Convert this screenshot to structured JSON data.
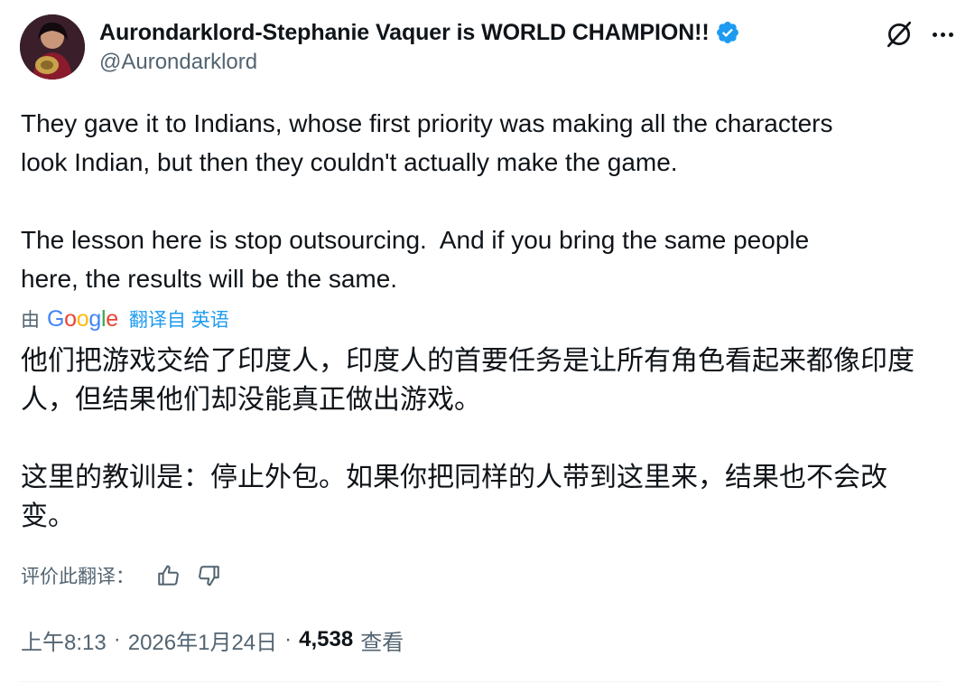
{
  "author": {
    "display_name": "Aurondarklord-Stephanie Vaquer is WORLD CHAMPION!!",
    "handle": "@Aurondarklord",
    "verified": true,
    "avatar_icon": "user-avatar"
  },
  "icons": {
    "verified": "verified-badge-icon",
    "grok": "grok-icon",
    "more": "more-options-icon",
    "thumbs_up": "thumbs-up-icon",
    "thumbs_down": "thumbs-down-icon"
  },
  "tweet": {
    "text": "They gave it to Indians, whose first priority was making all the characters\nlook Indian, but then they couldn't actually make the game.\n\nThe lesson here is stop outsourcing.  And if you bring the same people\nhere, the results will be the same."
  },
  "translation": {
    "by_label": "由",
    "provider": "Google",
    "link_text": "翻译自 英语",
    "text": "他们把游戏交给了印度人，印度人的首要任务是让所有角色看起来都像印度\n人，但结果他们却没能真正做出游戏。\n\n这里的教训是：停止外包。如果你把同样的人带到这里来，结果也不会改\n变。",
    "rate_label": "评价此翻译："
  },
  "meta": {
    "time": "上午8:13",
    "separator": "·",
    "date": "2026年1月24日",
    "views_count": "4,538",
    "views_label": "查看"
  },
  "colors": {
    "text_primary": "#0f1419",
    "text_secondary": "#536471",
    "accent": "#1d9bf0"
  }
}
